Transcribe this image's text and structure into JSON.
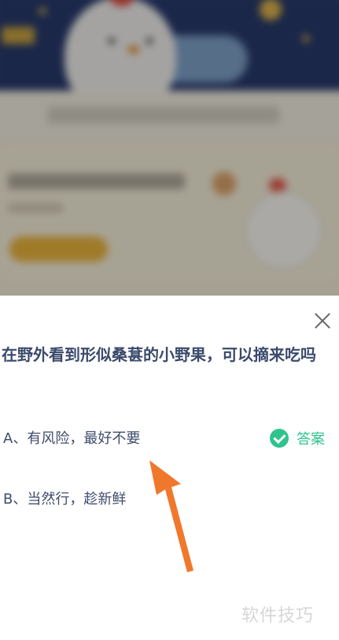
{
  "quiz": {
    "question": "在野外看到形似桑葚的小野果，可以摘来吃吗",
    "options": [
      {
        "label": "A、有风险，最好不要",
        "is_answer": true
      },
      {
        "label": "B、当然行，趁新鲜",
        "is_answer": false
      }
    ],
    "answer_label": "答案"
  },
  "watermark": "软件技巧",
  "icons": {
    "close": "close-icon",
    "answer": "check-circle-icon",
    "pointer": "arrow-up-icon"
  },
  "colors": {
    "answer_green": "#2fc48d",
    "arrow_orange": "#f0782c",
    "question_text": "#3b4a6b"
  }
}
